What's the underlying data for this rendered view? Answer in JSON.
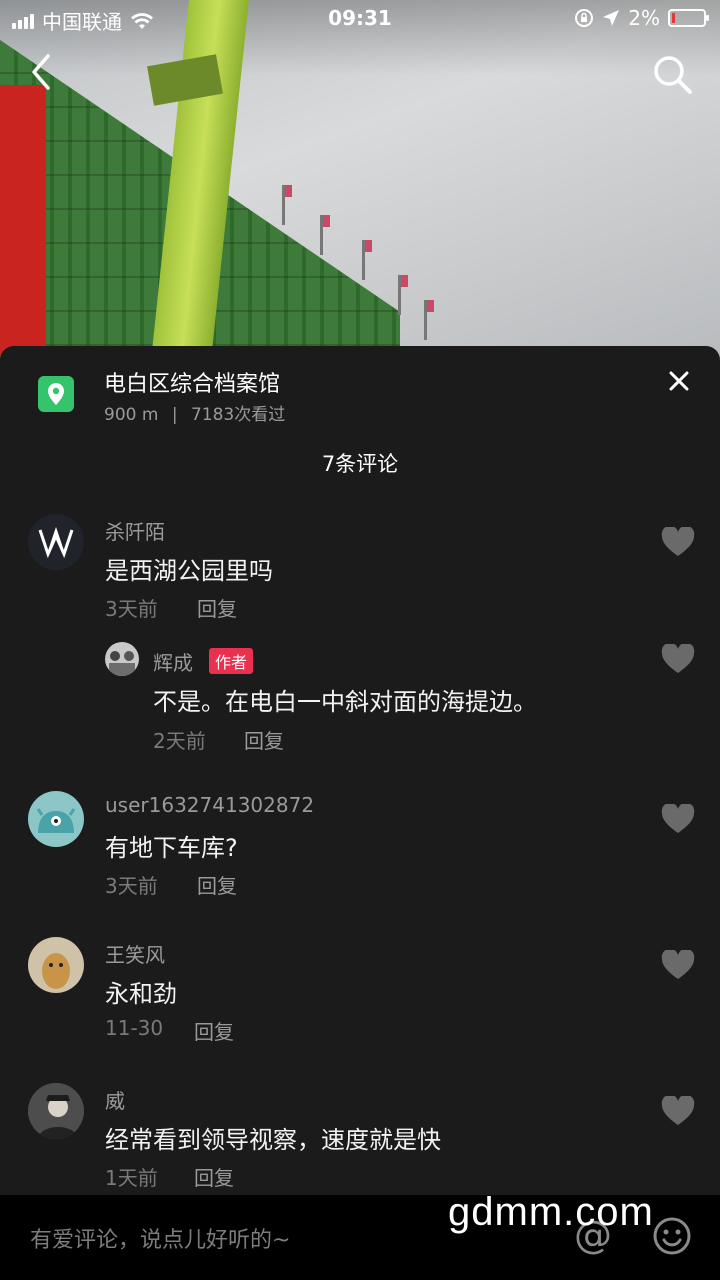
{
  "status_bar": {
    "carrier": "中国联通",
    "time": "09:31",
    "battery_percent": "2%"
  },
  "location": {
    "title": "电白区综合档案馆",
    "distance": "900 m",
    "separator": "|",
    "views": "7183次看过"
  },
  "comment_count": "7条评论",
  "comments": [
    {
      "name": "杀阡陌",
      "text": "是西湖公园里吗",
      "time": "3天前",
      "reply": "回复"
    },
    {
      "name": "辉成",
      "badge": "作者",
      "text": "不是。在电白一中斜对面的海提边。",
      "time": "2天前",
      "reply": "回复"
    },
    {
      "name": "user1632741302872",
      "text": "有地下车库?",
      "time": "3天前",
      "reply": "回复"
    },
    {
      "name": "王笑风",
      "text": "永和劲",
      "time": "11-30",
      "reply": "回复"
    },
    {
      "name": "威",
      "text": "经常看到领导视察，速度就是快",
      "time": "1天前",
      "reply": "回复"
    }
  ],
  "input": {
    "placeholder": "有爱评论，说点儿好听的~",
    "at_symbol": "@"
  },
  "watermark": "gdmm.com"
}
